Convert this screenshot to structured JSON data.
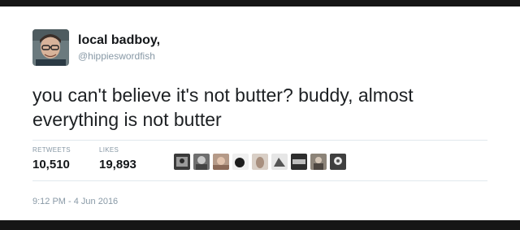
{
  "tweet": {
    "author": {
      "display_name": "local badboy,",
      "handle": "@hippieswordfish"
    },
    "text": "you can't believe it's not butter? buddy, almost everything is not butter",
    "stats": {
      "retweets_label": "RETWEETS",
      "retweets_count": "10,510",
      "likes_label": "LIKES",
      "likes_count": "19,893"
    },
    "liker_avatars": 9,
    "timestamp": "9:12 PM - 4 Jun 2016"
  },
  "colors": {
    "card_background": "#ffffff",
    "frame_background": "#161616",
    "primary_text": "#14171a",
    "secondary_text": "#8899a6",
    "divider": "#e1e8ed"
  }
}
